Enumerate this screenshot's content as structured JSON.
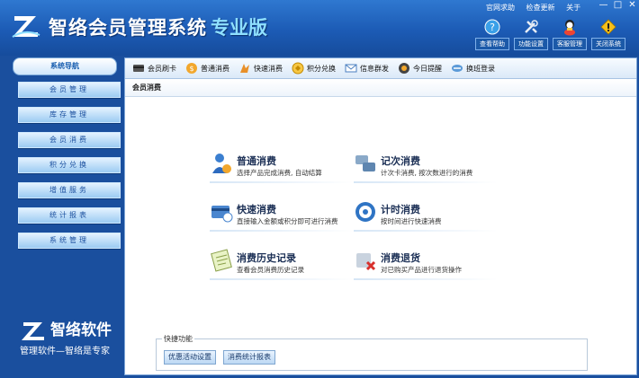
{
  "app": {
    "title": "智络会员管理系统",
    "edition": "专业版",
    "top_links": [
      "官网求助",
      "检查更新",
      "关于"
    ],
    "window_controls": [
      "—",
      "□",
      "✕"
    ],
    "tools": [
      {
        "label": "查看帮助",
        "icon": "help-icon"
      },
      {
        "label": "功能设置",
        "icon": "tools-icon"
      },
      {
        "label": "客服管理",
        "icon": "customer-service-icon"
      },
      {
        "label": "关闭系统",
        "icon": "warning-icon"
      }
    ]
  },
  "sidebar": {
    "header": "系统导航",
    "items": [
      "会员管理",
      "库存管理",
      "会员消费",
      "积分兑换",
      "增值服务",
      "统计报表",
      "系统管理"
    ],
    "brand_name": "智络软件",
    "slogan": "管理软件—智络是专家"
  },
  "toolbar": {
    "items": [
      {
        "label": "会员刷卡",
        "icon": "card-icon"
      },
      {
        "label": "普通消费",
        "icon": "consume-icon"
      },
      {
        "label": "快速消费",
        "icon": "fast-consume-icon"
      },
      {
        "label": "积分兑换",
        "icon": "points-exchange-icon"
      },
      {
        "label": "信息群发",
        "icon": "message-icon"
      },
      {
        "label": "今日提醒",
        "icon": "reminder-icon"
      },
      {
        "label": "换班登录",
        "icon": "shift-login-icon"
      }
    ]
  },
  "section": {
    "title": "会员消费"
  },
  "functions": [
    {
      "title": "普通消费",
      "desc": "选择产品完成消费, 自动结算",
      "icon": "person-consume-icon"
    },
    {
      "title": "记次消费",
      "desc": "计次卡消费, 按次数进行的消费",
      "icon": "count-consume-icon"
    },
    {
      "title": "快速消费",
      "desc": "直接输入金额或积分即可进行消费",
      "icon": "quick-consume-icon"
    },
    {
      "title": "计时消费",
      "desc": "按时间进行快速消费",
      "icon": "timer-consume-icon"
    },
    {
      "title": "消费历史记录",
      "desc": "查看会员消费历史记录",
      "icon": "history-icon"
    },
    {
      "title": "消费退货",
      "desc": "对已购买产品进行退货操作",
      "icon": "return-icon"
    }
  ],
  "quick": {
    "title": "快捷功能",
    "buttons": [
      "优惠活动设置",
      "消费统计报表"
    ]
  },
  "colors": {
    "brand_blue": "#1c5bb5",
    "accent_cyan": "#8fe0ff"
  }
}
